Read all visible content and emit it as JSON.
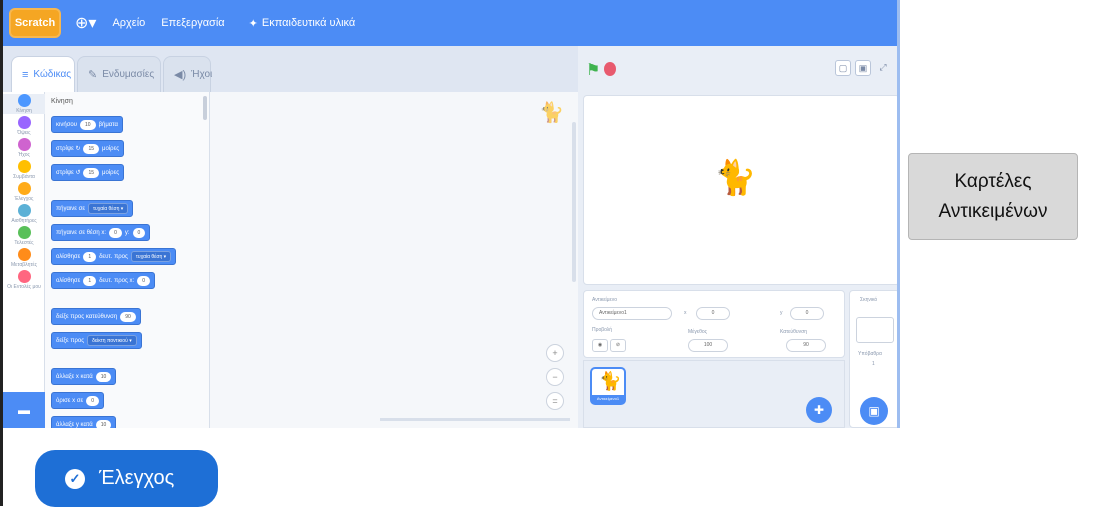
{
  "menubar": {
    "logo": "Scratch",
    "items": [
      "Αρχείο",
      "Επεξεργασία",
      "Εκπαιδευτικά υλικά"
    ]
  },
  "tabs": [
    {
      "label": "Κώδικας",
      "icon": "code-icon"
    },
    {
      "label": "Ενδυμασίες",
      "icon": "brush-icon"
    },
    {
      "label": "Ήχοι",
      "icon": "speaker-icon"
    }
  ],
  "categories": [
    {
      "label": "Κίνηση",
      "color": "#4c97ff"
    },
    {
      "label": "Όψεις",
      "color": "#9966ff"
    },
    {
      "label": "Ήχος",
      "color": "#cf63cf"
    },
    {
      "label": "Συμβάντα",
      "color": "#ffbf00"
    },
    {
      "label": "Έλεγχος",
      "color": "#ffab19"
    },
    {
      "label": "Αισθητήρες",
      "color": "#5cb1d6"
    },
    {
      "label": "Τελεστές",
      "color": "#59c059"
    },
    {
      "label": "Μεταβλητές",
      "color": "#ff8c1a"
    },
    {
      "label": "Οι Εντολές μου",
      "color": "#ff6680"
    }
  ],
  "palette": {
    "title": "Κίνηση",
    "blocks": [
      {
        "text": "κινήσου",
        "pill": "10",
        "after": "βήματα"
      },
      {
        "text": "στρίψε ↻",
        "pill": "15",
        "after": "μοίρες"
      },
      {
        "text": "στρίψε ↺",
        "pill": "15",
        "after": "μοίρες"
      },
      {
        "text": "πήγαινε σε",
        "dd": "τυχαία θέση ▾"
      },
      {
        "text": "πήγαινε σε θέση x:",
        "pill": "0",
        "after": "y:",
        "pill2": "0"
      },
      {
        "text": "ολίσθησε",
        "pill": "1",
        "after": "δευτ. προς",
        "dd": "τυχαία θέση ▾"
      },
      {
        "text": "ολίσθησε",
        "pill": "1",
        "after": "δευτ. προς x:",
        "pill2": "0"
      },
      {
        "text": "δείξε προς κατεύθυνση",
        "pill": "90"
      },
      {
        "text": "δείξε προς",
        "dd": "δείκτη ποντικιού ▾"
      },
      {
        "text": "άλλαξε x κατά",
        "pill": "10"
      },
      {
        "text": "όρισε x σε",
        "pill": "0"
      },
      {
        "text": "άλλαξε y κατά",
        "pill": "10"
      }
    ]
  },
  "sprite_info": {
    "sprite_label": "Αντικείμενο",
    "sprite_name": "Αντικείμενο1",
    "x_label": "x",
    "x_value": "0",
    "y_label": "y",
    "y_value": "0",
    "show_label": "Προβολή",
    "size_label": "Μέγεθος",
    "size_value": "100",
    "direction_label": "Κατεύθυνση",
    "direction_value": "90"
  },
  "sprite_list": {
    "sprites": [
      "Αντικείμενο1"
    ]
  },
  "stage_panel": {
    "title": "Σκηνικό",
    "backdrops_label": "Υπόβαθρα",
    "backdrops_count": "1"
  },
  "callout": {
    "line1": "Καρτέλες",
    "line2": "Αντικειμένων"
  },
  "check_button": {
    "label": "Έλεγχος"
  }
}
